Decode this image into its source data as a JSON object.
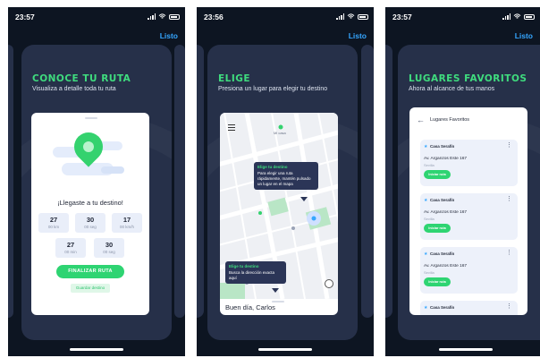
{
  "status": {
    "time1": "23:57",
    "time2": "23:56",
    "time3": "23:57"
  },
  "done_label": "Listo",
  "screen1": {
    "title": "CONOCE TU RUTA",
    "subtitle": "Visualiza a detalle toda tu ruta",
    "arrived": "¡Llegaste a tu destino!",
    "stats": [
      {
        "value": "27",
        "unit": "00 km"
      },
      {
        "value": "30",
        "unit": "00 seg"
      },
      {
        "value": "17",
        "unit": "00 km/h"
      },
      {
        "value": "27",
        "unit": "00 min"
      },
      {
        "value": "30",
        "unit": "00 seg"
      }
    ],
    "finish_button": "FINALIZAR RUTA",
    "share_button": "Guardar destino"
  },
  "screen2": {
    "title": "ELIGE",
    "subtitle": "Presiona un lugar para elegir tu destino",
    "tooltip1": {
      "title": "Elige tu destino",
      "body": "Para elegir una ruta rápidamente, mantén pulsado un lugar en el mapa"
    },
    "tooltip2": {
      "title": "Elige tu destino",
      "body": "Busca la dirección exacta aquí"
    },
    "map_label": "Mi casa",
    "greeting": "Buen día, Carlos"
  },
  "screen3": {
    "title": "LUGARES FAVORITOS",
    "subtitle": "Ahora al alcance de tus manos",
    "header": "Lugares Favoritos",
    "favorites": [
      {
        "name": "Casa Serafín",
        "address": "Av. Arganzos Este 167",
        "city": "Sevilla",
        "button": "Iniciar ruta"
      },
      {
        "name": "Casa Serafín",
        "address": "Av. Arganzos Este 167",
        "city": "Sevilla",
        "button": "Iniciar ruta"
      },
      {
        "name": "Casa Serafín",
        "address": "Av. Arganzos Este 167",
        "city": "Sevilla",
        "button": "Iniciar ruta"
      },
      {
        "name": "Casa Serafín"
      }
    ]
  },
  "colors": {
    "background": "#0d1522",
    "card": "#263049",
    "accent_green": "#3fdc7e",
    "link_blue": "#35a6ff"
  }
}
